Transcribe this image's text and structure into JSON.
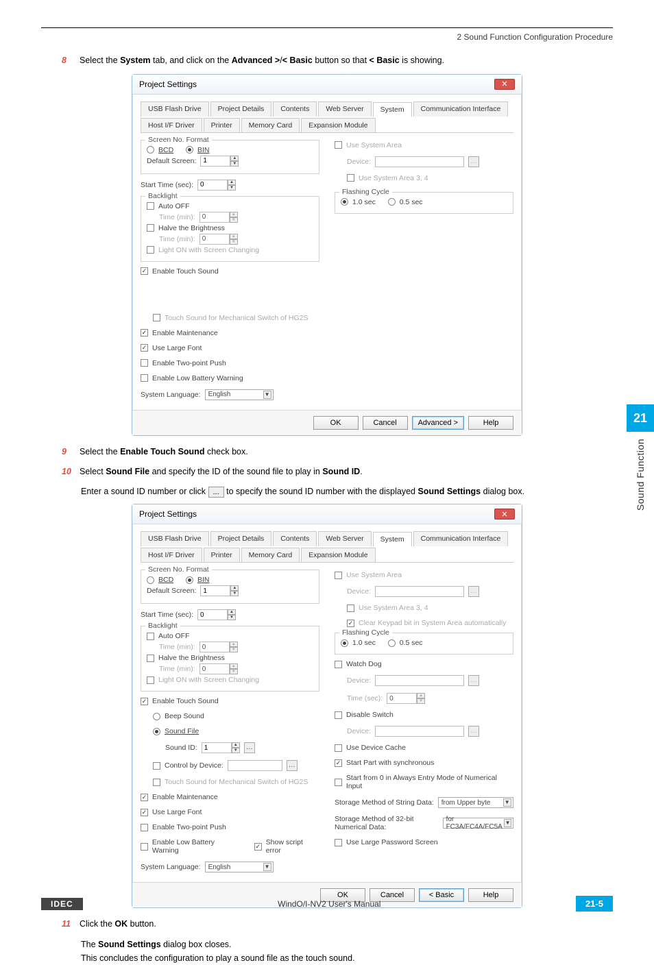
{
  "header": {
    "breadcrumb": "2 Sound Function Configuration Procedure"
  },
  "steps": {
    "s8": {
      "num": "8",
      "pre": "Select the ",
      "a": "System",
      "mid1": " tab, and click on the ",
      "b": "Advanced >",
      "slash": "/",
      "c": "< Basic",
      "mid2": " button so that ",
      "d": "< Basic",
      "post": " is showing."
    },
    "s9": {
      "num": "9",
      "pre": "Select the ",
      "a": "Enable Touch Sound",
      "post": " check box."
    },
    "s10": {
      "num": "10",
      "pre": "Select ",
      "a": "Sound File",
      "mid": " and specify the ID of the sound file to play in ",
      "b": "Sound ID",
      "post": "."
    },
    "s10b": {
      "pre": "Enter a sound ID number or click ",
      "icon": "...",
      "mid": " to specify the sound ID number with the displayed ",
      "a": "Sound Settings",
      "post": " dialog box."
    },
    "s11": {
      "num": "11",
      "pre": "Click the ",
      "a": "OK",
      "post": " button."
    },
    "s11b": "The Sound Settings dialog box closes.",
    "s11c": "This concludes the configuration to play a sound file as the touch sound."
  },
  "dlg": {
    "title": "Project Settings",
    "tabs": [
      "USB Flash Drive",
      "Project Details",
      "Contents",
      "Web Server",
      "System",
      "Communication Interface",
      "Host I/F Driver",
      "Printer",
      "Memory Card",
      "Expansion Module"
    ],
    "screenNoFormat": "Screen No. Format",
    "bcd": "BCD",
    "bin": "BIN",
    "defaultScreen": "Default Screen:",
    "defaultScreenVal": "1",
    "startTime": "Start Time (sec):",
    "startTimeVal": "0",
    "backlight": "Backlight",
    "autoOff": "Auto OFF",
    "timeMin": "Time (min):",
    "timeMinVal": "0",
    "halve": "Halve the Brightness",
    "lightOn": "Light ON with Screen Changing",
    "enableTouch": "Enable Touch Sound",
    "touchMech": "Touch Sound for Mechanical Switch of HG2S",
    "enableMaint": "Enable Maintenance",
    "useLarge": "Use Large Font",
    "twoPoint": "Enable Two-point Push",
    "lowBatt": "Enable Low Battery Warning",
    "sysLang": "System Language:",
    "sysLangVal": "English",
    "useSysArea": "Use System Area",
    "device": "Device:",
    "useSysArea34": "Use System Area 3, 4",
    "flashCycle": "Flashing Cycle",
    "fc10": "1.0 sec",
    "fc05": "0.5 sec",
    "ok": "OK",
    "cancel": "Cancel",
    "adv": "Advanced >",
    "basic": "< Basic",
    "help": "Help"
  },
  "dlg2": {
    "beepSound": "Beep Sound",
    "soundFile": "Sound File",
    "soundId": "Sound ID:",
    "soundIdVal": "1",
    "ctrlDev": "Control by Device:",
    "showScript": "Show script error",
    "clearKeypad": "Clear Keypad bit in System Area automatically",
    "watchDog": "Watch Dog",
    "timesec": "Time (sec):",
    "timesecVal": "0",
    "disableSwitch": "Disable Switch",
    "useDevCache": "Use Device Cache",
    "startSync": "Start Part with synchronous",
    "startFrom0": "Start from 0 in Always Entry Mode of Numerical Input",
    "storageString": "Storage Method of String Data:",
    "storageStringVal": "from Upper byte",
    "storage32": "Storage Method of 32-bit Numerical Data:",
    "storage32Val": "for FC3A/FC4A/FC5A",
    "useLargePwd": "Use Large Password Screen"
  },
  "side": {
    "num": "21",
    "label": "Sound Function"
  },
  "footer": {
    "logo": "IDEC",
    "center": "WindO/I-NV2 User's Manual",
    "pnum": "21-5"
  }
}
